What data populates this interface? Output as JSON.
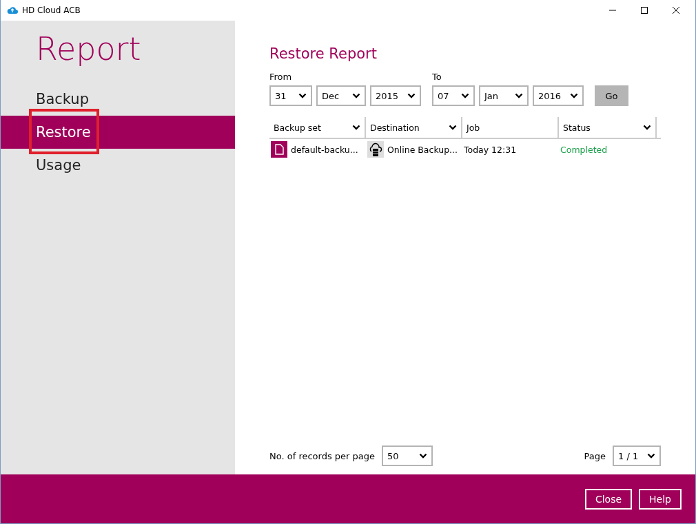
{
  "window": {
    "title": "HD Cloud ACB"
  },
  "sidebar": {
    "heading": "Report",
    "items": [
      {
        "label": "Backup",
        "selected": false,
        "highlighted": false
      },
      {
        "label": "Restore",
        "selected": true,
        "highlighted": true
      },
      {
        "label": "Usage",
        "selected": false,
        "highlighted": false
      }
    ]
  },
  "main": {
    "title": "Restore Report",
    "from": {
      "label": "From",
      "fields": [
        "31",
        "Dec",
        "2015"
      ]
    },
    "to": {
      "label": "To",
      "fields": [
        "07",
        "Jan",
        "2016"
      ]
    },
    "go_button": "Go",
    "table": {
      "columns": [
        {
          "label": "Backup set",
          "sortable": true
        },
        {
          "label": "Destination",
          "sortable": true
        },
        {
          "label": "Job",
          "sortable": false
        },
        {
          "label": "Status",
          "sortable": true
        }
      ],
      "rows": [
        {
          "backup_set": "default-backu...",
          "destination": "Online Backup...",
          "job": "Today 12:31",
          "status": "Completed",
          "color": "#1aa04a"
        }
      ]
    },
    "records_label": "No. of records per page",
    "records_value": "50",
    "page_label": "Page",
    "page_value": "1 / 1"
  },
  "footer": {
    "buttons": [
      "Close",
      "Help"
    ]
  }
}
